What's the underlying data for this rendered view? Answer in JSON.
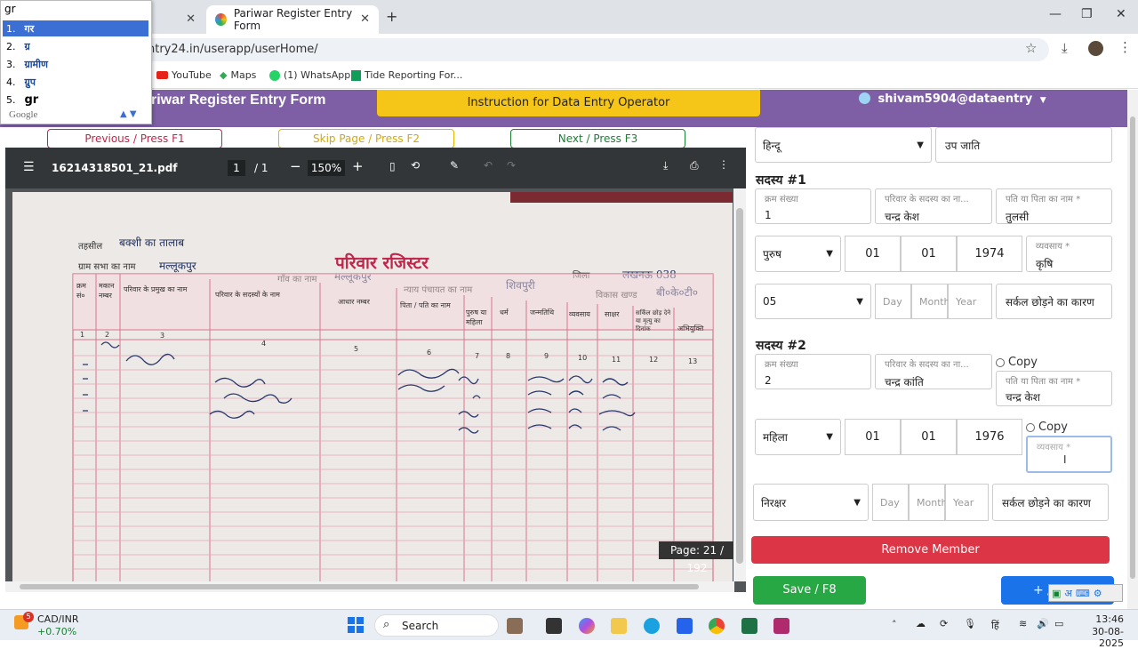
{
  "browser": {
    "tabs": [
      {
        "label": ""
      },
      {
        "label": "Pariwar Register Entry Form"
      }
    ],
    "new_tab": "+",
    "url": "ntry24.in/userapp/userHome/",
    "bookmarks": [
      "YouTube",
      "Maps",
      "(1) WhatsApp",
      "Tide Reporting For..."
    ]
  },
  "ime": {
    "input": "gr",
    "candidates": [
      {
        "num": "1.",
        "text": "गर"
      },
      {
        "num": "2.",
        "text": "ग्र"
      },
      {
        "num": "3.",
        "text": "ग्रामीण"
      },
      {
        "num": "4.",
        "text": "ग्रुप"
      },
      {
        "num": "5.",
        "text": "gr"
      }
    ],
    "brand": "Google"
  },
  "app": {
    "title": "riwar Register Entry Form",
    "instruction_button": "Instruction for Data Entry Operator",
    "user": "shivam5904@dataentry",
    "nav": {
      "previous": "Previous / Press F1",
      "skip": "Skip Page / Press F2",
      "next": "Next / Press F3"
    }
  },
  "pdf": {
    "filename": "16214318501_21.pdf",
    "page_current": "1",
    "page_total": "/ 1",
    "zoom": "150%",
    "page_badge": "Page: 21 / 192",
    "doc": {
      "title": "परिवार रजिस्टर",
      "labels": {
        "tehsil": "तहसील",
        "gram_sabha": "ग्राम सभा का नाम",
        "gaon": "गाँव का नाम",
        "nyay": "न्याय पंचायत का नाम",
        "jila": "जिला",
        "vikas": "विकास खण्ड"
      },
      "handwritten": {
        "tehsil": "बक्शी का तालाब",
        "gram_sabha": "मल्लूकपुर",
        "gaon": "मल्लूकपुर",
        "nyay": "शिवपुरी",
        "jila": "लखनऊ 038",
        "vikas": "बी०के०टी०"
      },
      "columns": [
        "क्रम सं०",
        "मकान नम्बर",
        "परिवार के प्रमुख का नाम",
        "परिवार के सदस्यों के नाम",
        "आधार नम्बर",
        "पिता / पति का नाम",
        "पुरुष या महिला",
        "धर्म",
        "जन्मतिथि",
        "व्यवसाय",
        "साक्षर",
        "सर्किल छोड़ देने या मृत्यु का दिनांक",
        "अभियुक्ति"
      ],
      "col_numbers": [
        "1",
        "2",
        "3",
        "4",
        "5",
        "6",
        "7",
        "8",
        "9",
        "10",
        "11",
        "12",
        "13"
      ]
    }
  },
  "form": {
    "caste_select": "हिन्दू",
    "subcaste": "उप जाति",
    "members": [
      {
        "heading": "सदस्य #1",
        "serial_label": "क्रम संख्या",
        "serial": "1",
        "name_label": "परिवार के सदस्य का ना...",
        "name": "चन्द्र केश",
        "father_label": "पति या पिता का नाम *",
        "father": "तुलसी",
        "gender": "पुरुष",
        "dd": "01",
        "mm": "01",
        "yyyy": "1974",
        "occ_label": "व्यवसाय *",
        "occ": "कृषि",
        "edu": "05",
        "day_ph": "Day",
        "month_ph": "Month",
        "year_ph": "Year",
        "leave": "सर्कल छोड़ने का कारण"
      },
      {
        "heading": "सदस्य #2",
        "serial_label": "क्रम संख्या",
        "serial": "2",
        "name_label": "परिवार के सदस्य का ना...",
        "name": "चन्द्र कांति",
        "father_label": "पति या पिता का नाम *",
        "father": "चन्द्र केश",
        "copy1": "Copy",
        "copy2": "Copy",
        "gender": "महिला",
        "dd": "01",
        "mm": "01",
        "yyyy": "1976",
        "occ_label": "व्यवसाय *",
        "occ": "",
        "edu": "निरक्षर",
        "day_ph": "Day",
        "month_ph": "Month",
        "year_ph": "Year",
        "leave": "सर्कल छोड़ने का कारण"
      }
    ],
    "remove_member": "Remove Member",
    "save": "Save / F8",
    "add": "+ /"
  },
  "taskbar": {
    "ticker": "CAD/INR",
    "ticker_change": "+0.70%",
    "badge": "5",
    "search": "Search",
    "lang": "हिं",
    "time": "13:46",
    "date": "30-08-2025"
  },
  "colors": {
    "header_purple": "#7e5fa6",
    "instr_yellow": "#f5c518",
    "remove_red": "#dc3545",
    "save_green": "#28a745",
    "add_blue": "#1a73e8",
    "ink_red": "#c0254a"
  }
}
